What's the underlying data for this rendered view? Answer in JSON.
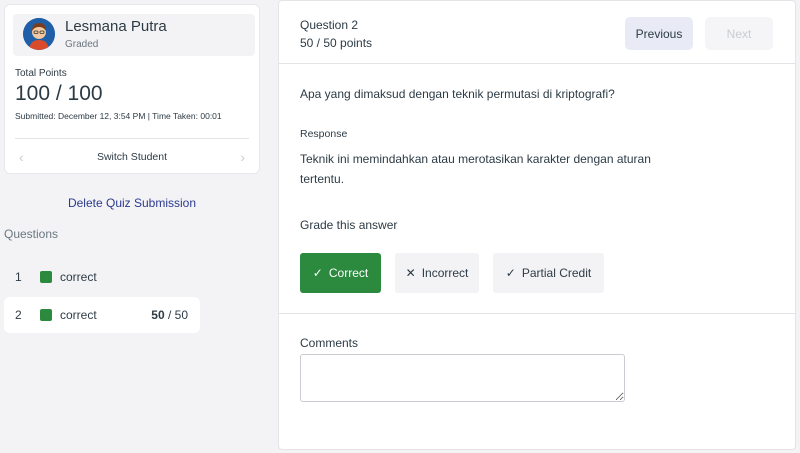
{
  "student": {
    "name": "Lesmana Putra",
    "status": "Graded",
    "points_label": "Total Points",
    "points_value": "100 / 100",
    "submitted": "Submitted: December 12, 3:54 PM | Time Taken: 00:01",
    "switch_label": "Switch Student"
  },
  "delete_label": "Delete Quiz Submission",
  "questions_title": "Questions",
  "questions": [
    {
      "num": "1",
      "status": "correct",
      "score": ""
    },
    {
      "num": "2",
      "status": "correct",
      "score_earned": "50",
      "score_rest": " / 50"
    }
  ],
  "panel": {
    "title": "Question 2",
    "points": "50 / 50 points",
    "prev_label": "Previous",
    "next_label": "Next",
    "question_text": "Apa yang dimaksud dengan teknik permutasi di kriptografi?",
    "response_label": "Response",
    "response_text": "Teknik ini memindahkan atau merotasikan karakter dengan aturan tertentu.",
    "grade_label": "Grade this answer",
    "grade_correct": "Correct",
    "grade_incorrect": "Incorrect",
    "grade_partial": "Partial Credit",
    "comments_label": "Comments",
    "comments_value": ""
  },
  "colors": {
    "correct_green": "#2b8a3e",
    "link_blue": "#2b3a8c",
    "prev_bg": "#e8ebf5"
  },
  "icons": {
    "avatar": "user-avatar-icon",
    "prev": "chevron-left-icon",
    "next": "chevron-right-icon",
    "correct": "check-icon",
    "incorrect": "x-icon",
    "partial": "check-icon"
  }
}
